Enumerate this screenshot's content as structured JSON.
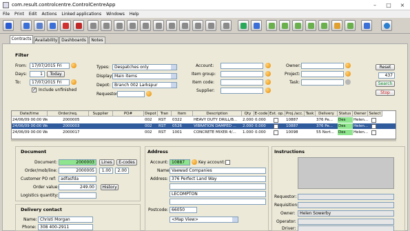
{
  "window": {
    "title": "com.result.controlcentre.ControlCentreApp"
  },
  "menu": [
    "File",
    "Print",
    "Edit",
    "Actions",
    "Linked applications",
    "Windows",
    "Help"
  ],
  "toolbar_icons": [
    "refresh-icon",
    "search-icon",
    "search-list-icon",
    "search-document-icon",
    "search-red-icon",
    "search-red2-icon",
    "grid1-icon",
    "grid2-icon",
    "grid3-icon",
    "grid4-icon",
    "grid5-icon",
    "grid6-icon",
    "grid7-icon",
    "grid8-icon",
    "grid9-icon",
    "grid10-icon",
    "cycle-icon",
    "cycle2-icon",
    "house-icon",
    "house2-icon",
    "house3-icon",
    "house4-icon",
    "house5-icon",
    "house6-icon",
    "house7-icon",
    "user-icon",
    "info-icon"
  ],
  "tabs": [
    "Contracts",
    "Availability",
    "Dashboards",
    "Notes"
  ],
  "filter": {
    "title": "Filter",
    "from_label": "From:",
    "from_value": "17/07/2015 Fri",
    "days_label": "Days:",
    "days_value": "1",
    "today_label": "Today",
    "to_label": "To:",
    "to_value": "17/07/2015 Fri",
    "include_unfinished": "Include unfinished",
    "types_label": "Types:",
    "types_value": "Despatches only",
    "display_label": "Display:",
    "display_value": "Main items",
    "depot_label": "Depot:",
    "depot_value": "Branch 002 Larkspur",
    "requestor_label": "Requestor:",
    "requestor_value": "",
    "account_label": "Account:",
    "itemgroup_label": "Item group:",
    "itemcode_label": "Item code:",
    "supplier_label": "Supplier:",
    "owner_label": "Owner:",
    "project_label": "Project:",
    "task_label": "Task:",
    "reset_label": "Reset",
    "count": "437",
    "search_label": "Search",
    "stop_label": "Stop"
  },
  "grid": {
    "columns": [
      "Date/time",
      "Order/req.",
      "Supplier",
      "PO#",
      "Depot",
      "Tran",
      "Item",
      "Description",
      "Qty",
      "E-code",
      "Ext. op.",
      "Proj./acc.",
      "Task",
      "Delivery",
      "Status",
      "Owner",
      "Select"
    ],
    "rows": [
      [
        "24/06/09 00:00 Wed",
        "2000005",
        "",
        "",
        "002",
        "RST",
        "0322",
        "HEAVY DUTY DRILL/B...",
        "2.000",
        "0.000",
        "",
        "10887",
        "",
        "376 Pe...",
        "Des",
        "Helen...",
        ""
      ],
      [
        "24/06/09 00:00 Wed",
        "2000003",
        "",
        "",
        "002",
        "RST",
        "0526",
        "VIBRATION DAMPED ...",
        "2.000",
        "0.000",
        "",
        "10887",
        "",
        "376 Pe...",
        "Des",
        "Helen...",
        ""
      ],
      [
        "24/06/09 00:00 Wed",
        "2000017",
        "",
        "",
        "002",
        "RST",
        "1001",
        "CONCRETE MIXER 4/...",
        "1.000",
        "0.000",
        "",
        "10098",
        "",
        "55 Nort...",
        "Des",
        "Helen...",
        ""
      ]
    ]
  },
  "document": {
    "title": "Document",
    "document_label": "Document:",
    "document_value": "2000003",
    "lines_label": "Lines",
    "ecodes_label": "E-codes",
    "ordermob_label": "Order/mob/line:",
    "ordermob_value": "2000005",
    "mob_value": "1.00",
    "line_value": "2.00",
    "custpo_label": "Customer PO ref:",
    "custpo_value": "adfasfda",
    "ordervalue_label": "Order value:",
    "ordervalue_value": "249.00",
    "history_label": "History",
    "logistics_label": "Logistics quantity:",
    "logistics_value": ""
  },
  "address": {
    "title": "Address",
    "account_label": "Account:",
    "account_value": "10887",
    "keyaccount_label": "Key account:",
    "name_label": "Name:",
    "name_value": "Vaewad Companies",
    "address_label": "Address:",
    "address_line1": "376  Perfect Land Way",
    "address_line2": "",
    "address_line3": "LECOMPTON",
    "address_line4": "",
    "postcode_label": "Postcode:",
    "postcode_value": "66050",
    "mapview_value": "<Map View>"
  },
  "instructions": {
    "title": "Instructions",
    "requestor_label": "Requestor:",
    "requisition_label": "Requisition:",
    "owner_label": "Owner:",
    "owner_value": "Helen Sowerby",
    "operator_label": "Operator:",
    "driver_label": "Driver:"
  },
  "delivery": {
    "title": "Delivery contact",
    "name_label": "Name:",
    "name_value": "Christi Morgan",
    "phone_label": "Phone:",
    "phone_value": "308 400-2911"
  },
  "colors": {
    "selected_row": "#2f5a9c",
    "status_green": "#8ee58e",
    "doc_green": "#8ee58e"
  }
}
